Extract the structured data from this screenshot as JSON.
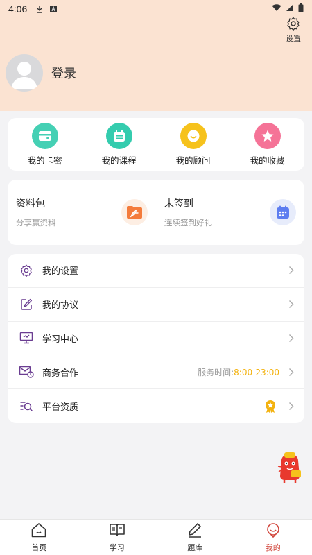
{
  "status_bar": {
    "time": "4:06"
  },
  "header": {
    "settings_label": "设置",
    "login_label": "登录"
  },
  "shortcuts": [
    {
      "label": "我的卡密",
      "icon": "card-icon",
      "color": "#3fcfb0"
    },
    {
      "label": "我的课程",
      "icon": "calendar-icon",
      "color": "#3fcfb0"
    },
    {
      "label": "我的顾问",
      "icon": "chat-bubble-icon",
      "color": "#f7c21d"
    },
    {
      "label": "我的收藏",
      "icon": "star-icon",
      "color": "#f5769a"
    }
  ],
  "promo": [
    {
      "title": "资料包",
      "subtitle": "分享赢资料",
      "icon": "folder-pdf-icon"
    },
    {
      "title": "未签到",
      "subtitle": "连续签到好礼",
      "icon": "calendar-checkin-icon"
    }
  ],
  "menu": [
    {
      "label": "我的设置",
      "icon": "gear-icon"
    },
    {
      "label": "我的协议",
      "icon": "edit-document-icon"
    },
    {
      "label": "学习中心",
      "icon": "monitor-icon"
    },
    {
      "label": "商务合作",
      "icon": "mail-clock-icon",
      "service_prefix": "服务时间:",
      "service_hours": "8:00-23:00"
    },
    {
      "label": "平台资质",
      "icon": "search-list-icon",
      "badge_icon": "medal-icon"
    }
  ],
  "tabs": [
    {
      "label": "首页",
      "icon": "home-icon"
    },
    {
      "label": "学习",
      "icon": "book-icon"
    },
    {
      "label": "题库",
      "icon": "pencil-icon"
    },
    {
      "label": "我的",
      "icon": "user-smile-icon",
      "active": true
    }
  ],
  "colors": {
    "header_bg": "#fbe3d2",
    "accent": "#d1453b",
    "menu_icon": "#6a3d91",
    "service_hours": "#f3b20f"
  }
}
